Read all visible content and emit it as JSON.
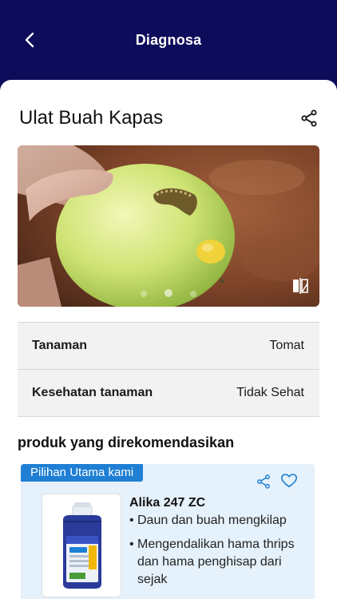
{
  "header": {
    "title": "Diagnosa"
  },
  "diagnosis": {
    "pest_name": "Ulat Buah Kapas",
    "carousel": {
      "total": 3,
      "active_index": 1
    }
  },
  "info_rows": [
    {
      "label": "Tanaman",
      "value": "Tomat"
    },
    {
      "label": "Kesehatan tanaman",
      "value": "Tidak Sehat"
    }
  ],
  "recommended": {
    "heading": "produk yang direkomendasikan",
    "products": [
      {
        "badge": "Pilihan Utama kami",
        "name": "Alika 247 ZC",
        "bullets": [
          "Daun dan buah mengkilap",
          "Mengendalikan hama thrips dan hama penghisap dari sejak"
        ]
      }
    ]
  },
  "colors": {
    "header_bg": "#0c0c5a",
    "badge_bg": "#1e7fd4",
    "card_bg": "#e5f1fb",
    "info_bg": "#f2f2f2"
  },
  "icons": [
    "back-arrow-icon",
    "share-icon",
    "compare-icon",
    "heart-icon"
  ]
}
